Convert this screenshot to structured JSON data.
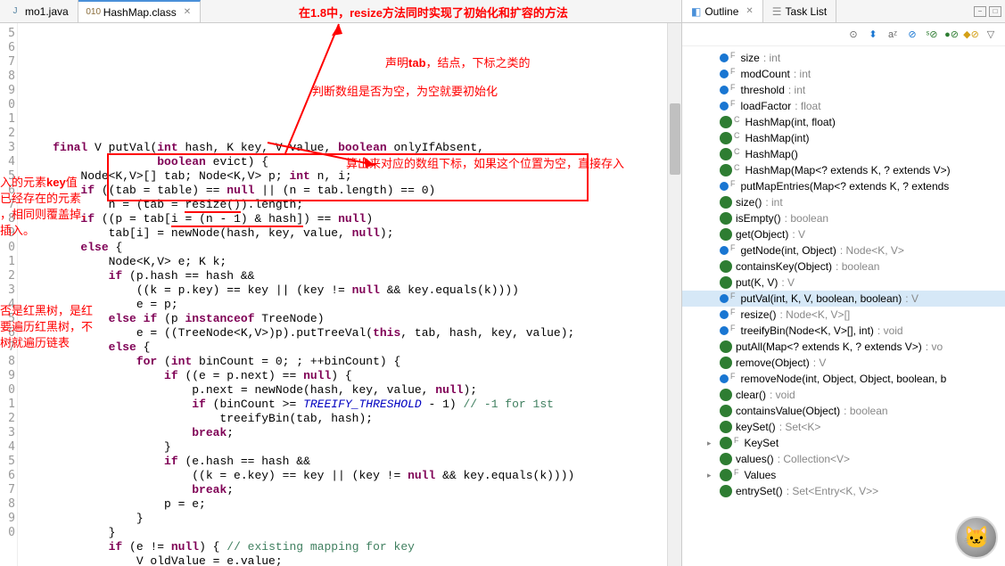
{
  "editor": {
    "tabs": [
      {
        "label": "mo1.java",
        "icon": "J"
      },
      {
        "label": "HashMap.class",
        "icon": "010"
      }
    ],
    "gutter_lines": [
      "5",
      "6",
      "7",
      "8",
      "9",
      "0",
      "1",
      "2",
      "3",
      "4",
      "5",
      "6",
      "7",
      "8",
      "9",
      "0",
      "1",
      "2",
      "3",
      "4",
      "5",
      "6",
      "7",
      "8",
      "9",
      "0",
      "1",
      "2",
      "3",
      "4",
      "5",
      "6",
      "7",
      "8",
      "9",
      "0"
    ],
    "code_tokens": [
      [
        {
          "t": "    "
        },
        {
          "t": "final",
          "c": "kw"
        },
        {
          "t": " V putVal("
        },
        {
          "t": "int",
          "c": "kw"
        },
        {
          "t": " hash, K key, V value, "
        },
        {
          "t": "boolean",
          "c": "kw"
        },
        {
          "t": " onlyIfAbsent,"
        }
      ],
      [
        {
          "t": "                   "
        },
        {
          "t": "boolean",
          "c": "kw"
        },
        {
          "t": " evict) {"
        }
      ],
      [
        {
          "t": "        Node<K,V>[] tab; Node<K,V> p; "
        },
        {
          "t": "int",
          "c": "kw"
        },
        {
          "t": " n, i;"
        }
      ],
      [
        {
          "t": "        "
        },
        {
          "t": "if",
          "c": "kw"
        },
        {
          "t": " ((tab = table) == "
        },
        {
          "t": "null",
          "c": "kw"
        },
        {
          "t": " || (n = tab.length) == 0)"
        }
      ],
      [
        {
          "t": "            n = (tab = "
        },
        {
          "t": "resize()",
          "c": "underline-red"
        },
        {
          "t": ").length;"
        }
      ],
      [
        {
          "t": "        "
        },
        {
          "t": "if",
          "c": "kw"
        },
        {
          "t": " ((p = tab["
        },
        {
          "t": "i = (n - 1) & hash]",
          "c": "underline-red"
        },
        {
          "t": ") == "
        },
        {
          "t": "null",
          "c": "kw"
        },
        {
          "t": ")"
        }
      ],
      [
        {
          "t": "            tab[i] = newNode(hash, key, value, "
        },
        {
          "t": "null",
          "c": "kw"
        },
        {
          "t": ");"
        }
      ],
      [
        {
          "t": "        "
        },
        {
          "t": "else",
          "c": "kw"
        },
        {
          "t": " {"
        }
      ],
      [
        {
          "t": "            Node<K,V> e; K k;"
        }
      ],
      [
        {
          "t": "            "
        },
        {
          "t": "if",
          "c": "kw"
        },
        {
          "t": " (p.hash == hash &&"
        }
      ],
      [
        {
          "t": "                ((k = p.key) == key || (key != "
        },
        {
          "t": "null",
          "c": "kw"
        },
        {
          "t": " && key.equals(k))))"
        }
      ],
      [
        {
          "t": "                e = p;"
        }
      ],
      [
        {
          "t": "            "
        },
        {
          "t": "else",
          "c": "kw"
        },
        {
          "t": " "
        },
        {
          "t": "if",
          "c": "kw"
        },
        {
          "t": " (p "
        },
        {
          "t": "instanceof",
          "c": "kw"
        },
        {
          "t": " TreeNode)"
        }
      ],
      [
        {
          "t": "                e = ((TreeNode<K,V>)p).putTreeVal("
        },
        {
          "t": "this",
          "c": "kw"
        },
        {
          "t": ", tab, hash, key, value);"
        }
      ],
      [
        {
          "t": "            "
        },
        {
          "t": "else",
          "c": "kw"
        },
        {
          "t": " {"
        }
      ],
      [
        {
          "t": "                "
        },
        {
          "t": "for",
          "c": "kw"
        },
        {
          "t": " ("
        },
        {
          "t": "int",
          "c": "kw"
        },
        {
          "t": " binCount = 0; ; ++binCount) {"
        }
      ],
      [
        {
          "t": "                    "
        },
        {
          "t": "if",
          "c": "kw"
        },
        {
          "t": " ((e = p.next) == "
        },
        {
          "t": "null",
          "c": "kw"
        },
        {
          "t": ") {"
        }
      ],
      [
        {
          "t": "                        p.next = newNode(hash, key, value, "
        },
        {
          "t": "null",
          "c": "kw"
        },
        {
          "t": ");"
        }
      ],
      [
        {
          "t": "                        "
        },
        {
          "t": "if",
          "c": "kw"
        },
        {
          "t": " (binCount >= "
        },
        {
          "t": "TREEIFY_THRESHOLD",
          "c": "const"
        },
        {
          "t": " - 1) "
        },
        {
          "t": "// -1 for 1st",
          "c": "com"
        }
      ],
      [
        {
          "t": "                            treeifyBin(tab, hash);"
        }
      ],
      [
        {
          "t": "                        "
        },
        {
          "t": "break",
          "c": "kw"
        },
        {
          "t": ";"
        }
      ],
      [
        {
          "t": "                    }"
        }
      ],
      [
        {
          "t": "                    "
        },
        {
          "t": "if",
          "c": "kw"
        },
        {
          "t": " (e.hash == hash &&"
        }
      ],
      [
        {
          "t": "                        ((k = e.key) == key || (key != "
        },
        {
          "t": "null",
          "c": "kw"
        },
        {
          "t": " && key.equals(k))))"
        }
      ],
      [
        {
          "t": "                        "
        },
        {
          "t": "break",
          "c": "kw"
        },
        {
          "t": ";"
        }
      ],
      [
        {
          "t": "                    p = e;"
        }
      ],
      [
        {
          "t": "                }"
        }
      ],
      [
        {
          "t": "            }"
        }
      ],
      [
        {
          "t": "            "
        },
        {
          "t": "if",
          "c": "kw"
        },
        {
          "t": " (e != "
        },
        {
          "t": "null",
          "c": "kw"
        },
        {
          "t": ") { "
        },
        {
          "t": "// existing mapping for key",
          "c": "com"
        }
      ],
      [
        {
          "t": "                V oldValue = e.value;"
        }
      ]
    ],
    "annotations": {
      "top": "在1.8中，resize方法同时实现了初始化和扩容的方法",
      "tab_desc": "声明tab，结点，下标之类的",
      "null_check": "判断数组是否为空，为空就要初始化",
      "index_calc": "算出来对应的数组下标，如果这个位置为空，直接存入",
      "side1": "入的元素key值",
      "side2": "已经存在的元素",
      "side3": "，相同则覆盖掉，",
      "side4": "插入。",
      "side5": "否是红黑树，是红",
      "side6": "要遍历红黑树，不",
      "side7": "树就遍历链表"
    }
  },
  "outline": {
    "tabs": [
      {
        "label": "Outline",
        "active": true
      },
      {
        "label": "Task List",
        "active": false
      }
    ],
    "toolbar_icons": [
      "sort",
      "filter",
      "az",
      "hide",
      "local",
      "public",
      "menu"
    ],
    "members": [
      {
        "vis": "def",
        "mod": "F",
        "name": "size",
        "type": ": int",
        "exp": ""
      },
      {
        "vis": "def",
        "mod": "F",
        "name": "modCount",
        "type": ": int",
        "exp": ""
      },
      {
        "vis": "def",
        "mod": "F",
        "name": "threshold",
        "type": ": int",
        "exp": ""
      },
      {
        "vis": "def",
        "mod": "F",
        "name": "loadFactor",
        "type": ": float",
        "exp": ""
      },
      {
        "vis": "pub",
        "mod": "C",
        "name": "HashMap(int, float)",
        "type": "",
        "exp": ""
      },
      {
        "vis": "pub",
        "mod": "C",
        "name": "HashMap(int)",
        "type": "",
        "exp": ""
      },
      {
        "vis": "pub",
        "mod": "C",
        "name": "HashMap()",
        "type": "",
        "exp": ""
      },
      {
        "vis": "pub",
        "mod": "C",
        "name": "HashMap(Map<? extends K, ? extends V>)",
        "type": "",
        "exp": ""
      },
      {
        "vis": "def",
        "mod": "F",
        "name": "putMapEntries(Map<? extends K, ? extends",
        "type": "",
        "exp": ""
      },
      {
        "vis": "pub",
        "mod": "",
        "name": "size()",
        "type": ": int",
        "exp": ""
      },
      {
        "vis": "pub",
        "mod": "",
        "name": "isEmpty()",
        "type": ": boolean",
        "exp": ""
      },
      {
        "vis": "pub",
        "mod": "",
        "name": "get(Object)",
        "type": ": V",
        "exp": ""
      },
      {
        "vis": "def",
        "mod": "F",
        "name": "getNode(int, Object)",
        "type": ": Node<K, V>",
        "exp": ""
      },
      {
        "vis": "pub",
        "mod": "",
        "name": "containsKey(Object)",
        "type": ": boolean",
        "exp": ""
      },
      {
        "vis": "pub",
        "mod": "",
        "name": "put(K, V)",
        "type": ": V",
        "exp": ""
      },
      {
        "vis": "def",
        "mod": "F",
        "name": "putVal(int, K, V, boolean, boolean)",
        "type": ": V",
        "exp": "",
        "selected": true
      },
      {
        "vis": "def",
        "mod": "F",
        "name": "resize()",
        "type": ": Node<K, V>[]",
        "exp": ""
      },
      {
        "vis": "def",
        "mod": "F",
        "name": "treeifyBin(Node<K, V>[], int)",
        "type": ": void",
        "exp": ""
      },
      {
        "vis": "pub",
        "mod": "",
        "name": "putAll(Map<? extends K, ? extends V>)",
        "type": ": vo",
        "exp": ""
      },
      {
        "vis": "pub",
        "mod": "",
        "name": "remove(Object)",
        "type": ": V",
        "exp": ""
      },
      {
        "vis": "def",
        "mod": "F",
        "name": "removeNode(int, Object, Object, boolean, b",
        "type": "",
        "exp": ""
      },
      {
        "vis": "pub",
        "mod": "",
        "name": "clear()",
        "type": ": void",
        "exp": ""
      },
      {
        "vis": "pub",
        "mod": "",
        "name": "containsValue(Object)",
        "type": ": boolean",
        "exp": ""
      },
      {
        "vis": "pub",
        "mod": "",
        "name": "keySet()",
        "type": ": Set<K>",
        "exp": ""
      },
      {
        "vis": "pub",
        "mod": "F",
        "name": "KeySet",
        "type": "",
        "exp": "▸"
      },
      {
        "vis": "pub",
        "mod": "",
        "name": "values()",
        "type": ": Collection<V>",
        "exp": ""
      },
      {
        "vis": "pub",
        "mod": "F",
        "name": "Values",
        "type": "",
        "exp": "▸"
      },
      {
        "vis": "pub",
        "mod": "",
        "name": "entrySet()",
        "type": ": Set<Entry<K, V>>",
        "exp": ""
      }
    ]
  }
}
